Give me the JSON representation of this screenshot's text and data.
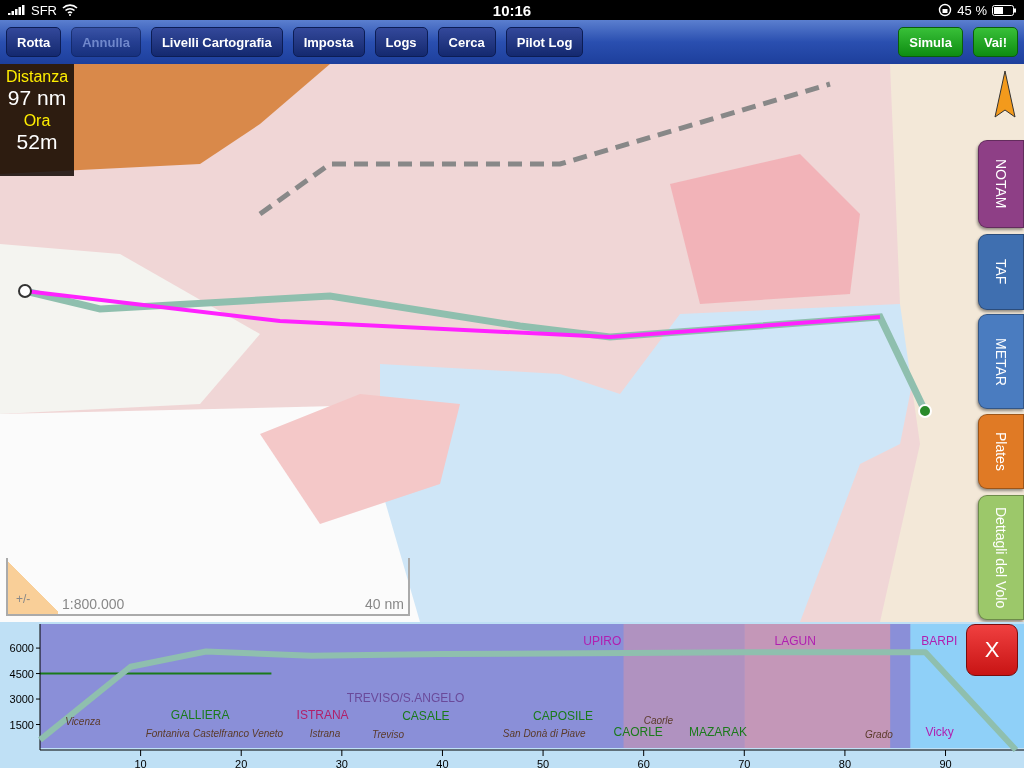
{
  "status_bar": {
    "carrier": "SFR",
    "time": "10:16",
    "battery": "45 %"
  },
  "toolbar": {
    "buttons": [
      {
        "label": "Rotta",
        "disabled": false
      },
      {
        "label": "Annulla",
        "disabled": true
      },
      {
        "label": "Livelli Cartografia",
        "disabled": false
      },
      {
        "label": "Imposta",
        "disabled": false
      },
      {
        "label": "Logs",
        "disabled": false
      },
      {
        "label": "Cerca",
        "disabled": false
      },
      {
        "label": "Pilot Log",
        "disabled": false
      }
    ],
    "actions": [
      {
        "label": "Simula"
      },
      {
        "label": "Vai!"
      }
    ]
  },
  "info_panel": {
    "distance_label": "Distanza",
    "distance": "97 nm",
    "time_label": "Ora",
    "time": "52m"
  },
  "side_tabs": [
    {
      "label": "NOTAM",
      "color": "#8e3f86"
    },
    {
      "label": "TAF",
      "color": "#3f6fb0"
    },
    {
      "label": "METAR",
      "color": "#4a7cc0"
    },
    {
      "label": "Plates",
      "color": "#e07a25"
    },
    {
      "label": "Dettagli del Volo",
      "color": "#9cc86a"
    }
  ],
  "scale": {
    "zoom": "+/-",
    "ratio": "1:800.000",
    "distance": "40 nm"
  },
  "close_button": "X",
  "profile": {
    "chart_data": {
      "type": "line",
      "xlim": [
        0,
        97.8
      ],
      "ylim": [
        0,
        7300
      ],
      "xticks": [
        10,
        20,
        30,
        40,
        50,
        60,
        70,
        80,
        90
      ],
      "yticks": [
        1500,
        3000,
        4500,
        6000
      ],
      "series": [
        {
          "color": "#8fbfae",
          "x": [
            0,
            9,
            16.5,
            27,
            40,
            70,
            88,
            97
          ],
          "values": [
            600,
            4900,
            5800,
            5550,
            5650,
            5750,
            5750,
            0
          ]
        }
      ]
    },
    "labels": [
      {
        "text": "Vicenza",
        "kind": "town"
      },
      {
        "text": "GALLIERA",
        "kind": "airfield"
      },
      {
        "text": "Fontaniva",
        "kind": "town"
      },
      {
        "text": "Castelfranco Veneto",
        "kind": "town"
      },
      {
        "text": "TREVISO/S.ANGELO",
        "kind": "airport"
      },
      {
        "text": "ISTRANA",
        "kind": "military"
      },
      {
        "text": "Istrana",
        "kind": "town"
      },
      {
        "text": "Treviso",
        "kind": "town"
      },
      {
        "text": "CASALE",
        "kind": "airfield"
      },
      {
        "text": "CAPOSILE",
        "kind": "airfield"
      },
      {
        "text": "San Donà di Piave",
        "kind": "town"
      },
      {
        "text": "Caorle",
        "kind": "town"
      },
      {
        "text": "CAORLE",
        "kind": "airfield"
      },
      {
        "text": "MAZARAK",
        "kind": "airfield"
      },
      {
        "text": "UPIRO",
        "kind": "reporting"
      },
      {
        "text": "LAGUN",
        "kind": "reporting"
      },
      {
        "text": "BARPI",
        "kind": "reporting"
      },
      {
        "text": "Grado",
        "kind": "town"
      },
      {
        "text": "Vicky",
        "kind": "reporting"
      }
    ]
  }
}
